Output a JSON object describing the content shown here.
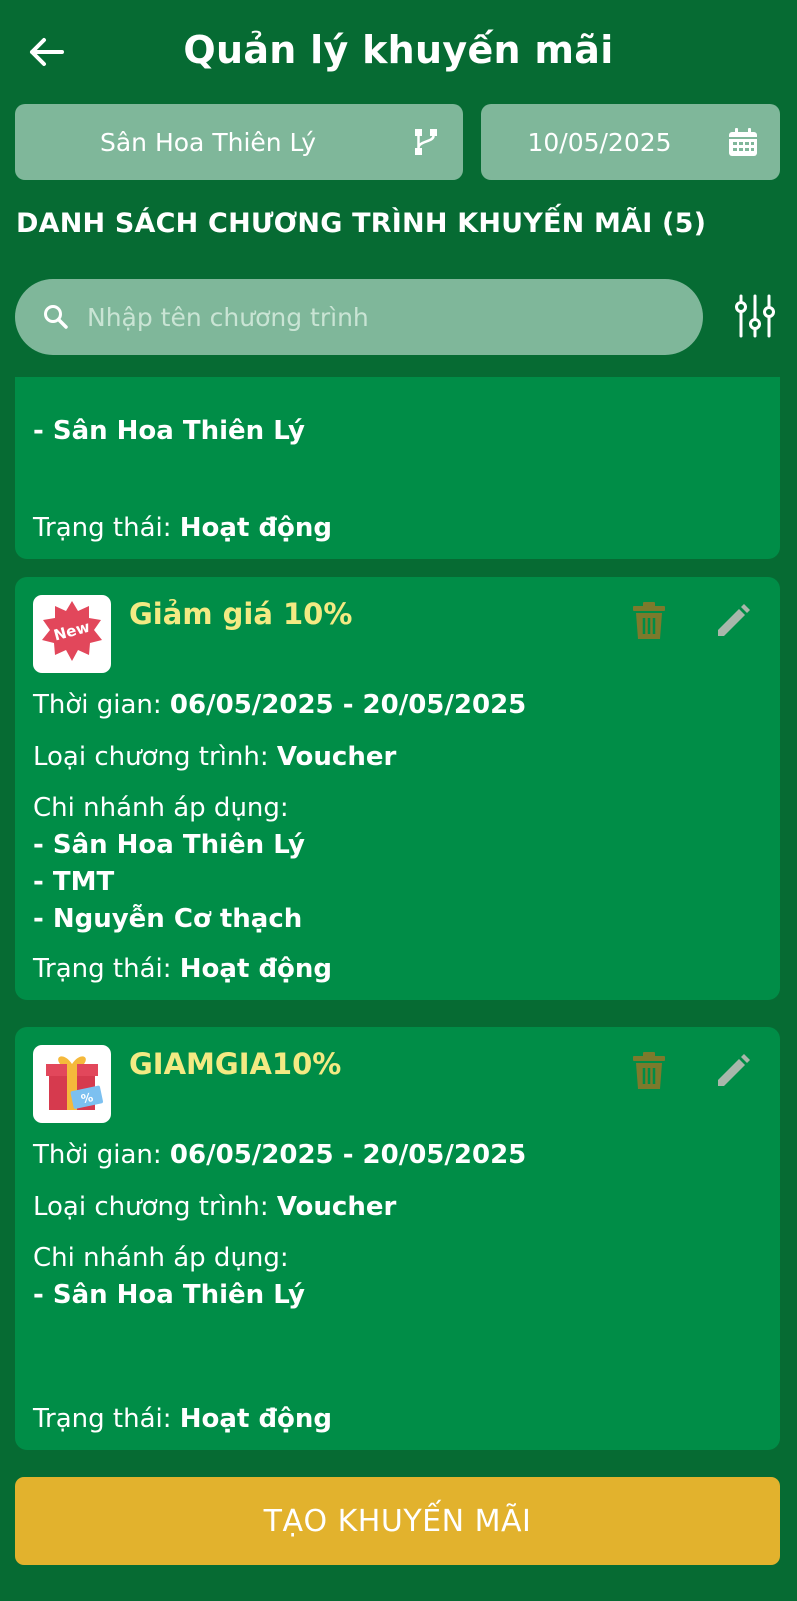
{
  "header": {
    "title": "Quản lý khuyến mãi",
    "back_icon": "arrow-left-icon"
  },
  "filters": {
    "branch": "Sân Hoa Thiên Lý",
    "branch_icon": "branch-tree-icon",
    "date": "10/05/2025",
    "date_icon": "calendar-icon"
  },
  "list": {
    "title": "DANH SÁCH CHƯƠNG TRÌNH KHUYẾN MÃI (5)"
  },
  "search": {
    "placeholder": "Nhập tên chương trình",
    "value": "",
    "filter_icon": "sliders-icon"
  },
  "labels": {
    "time": "Thời gian: ",
    "type": "Loại chương trình: ",
    "branches": "Chi nhánh áp dụng:",
    "status": "Trạng thái: "
  },
  "cards": [
    {
      "branches": [
        "- Sân Hoa Thiên Lý"
      ],
      "status": "Hoạt động"
    },
    {
      "name": "Giảm giá 10%",
      "image": "new-badge-icon",
      "time": "06/05/2025 - 20/05/2025",
      "type": "Voucher",
      "branches": [
        "- Sân Hoa Thiên Lý",
        "- TMT",
        "- Nguyễn Cơ thạch"
      ],
      "status": "Hoạt động"
    },
    {
      "name": "GIAMGIA10%",
      "image": "gift-voucher-icon",
      "time": "06/05/2025 - 20/05/2025",
      "type": "Voucher",
      "branches": [
        "- Sân Hoa Thiên Lý"
      ],
      "status": "Hoạt động"
    }
  ],
  "actions": {
    "delete_icon": "trash-icon",
    "edit_icon": "pencil-icon",
    "create_label": "TẠO KHUYẾN MÃI"
  },
  "colors": {
    "background": "#066b33",
    "card": "#008d47",
    "field": "#7fb79a",
    "promo_name": "#f3ea83",
    "create_button": "#e2b22d",
    "delete_icon": "#7c7a2c",
    "edit_icon": "#a9b7ab"
  }
}
